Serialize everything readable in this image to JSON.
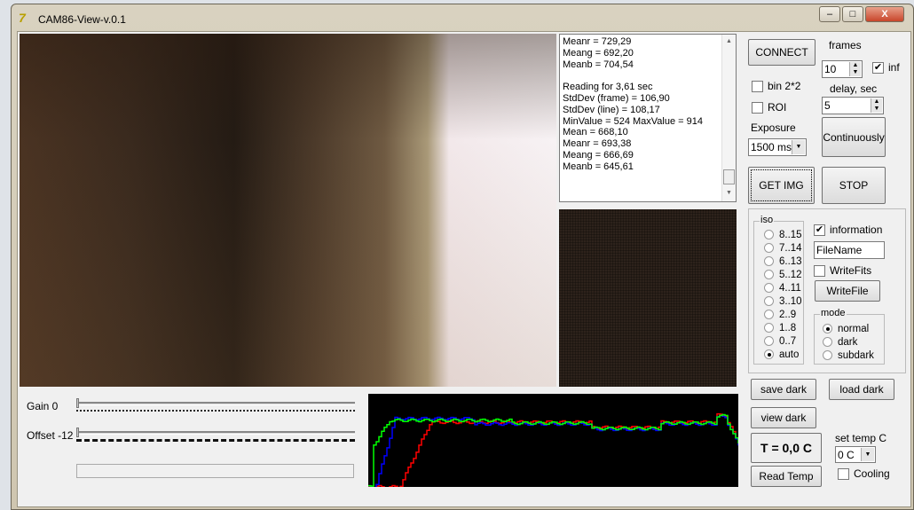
{
  "window": {
    "title": "CAM86-View-v.0.1",
    "minimize": "–",
    "maximize": "□",
    "close": "X"
  },
  "log": {
    "lines": [
      "Meanr = 729,29",
      "Meang = 692,20",
      "Meanb = 704,54",
      "",
      "Reading for 3,61 sec",
      "StdDev (frame) = 106,90",
      "StdDev (line) = 108,17",
      "MinValue = 524 MaxValue = 914",
      "Mean = 668,10",
      "Meanr = 693,38",
      "Meang = 666,69",
      "Meanb = 645,61"
    ]
  },
  "controls": {
    "connect": "CONNECT",
    "frames_label": "frames",
    "frames_value": "10",
    "inf_label": "inf",
    "inf_checked": true,
    "bin_label": "bin 2*2",
    "bin_checked": false,
    "roi_label": "ROI",
    "roi_checked": false,
    "delay_label": "delay, sec",
    "delay_value": "5",
    "exposure_label": "Exposure",
    "exposure_value": "1500 ms",
    "continuously": "Continuously",
    "get_img": "GET IMG",
    "stop": "STOP"
  },
  "iso": {
    "label": "iso",
    "options": [
      "8..15",
      "7..14",
      "6..13",
      "5..12",
      "4..11",
      "3..10",
      "2..9",
      "1..8",
      "0..7",
      "auto"
    ],
    "selected": "auto"
  },
  "info": {
    "information_label": "information",
    "information_checked": true,
    "filename": "FileName",
    "writefits_label": "WriteFits",
    "writefits_checked": false,
    "writefile": "WriteFile"
  },
  "mode": {
    "label": "mode",
    "options": [
      "normal",
      "dark",
      "subdark"
    ],
    "selected": "normal"
  },
  "dark": {
    "save": "save dark",
    "load": "load dark",
    "view": "view dark"
  },
  "temp": {
    "readout": "T = 0,0 C",
    "read": "Read Temp",
    "set_label": "set temp C",
    "set_value": "0 C",
    "cooling_label": "Cooling",
    "cooling_checked": false
  },
  "sliders": {
    "gain_label": "Gain 0",
    "gain_value": 0,
    "offset_label": "Offset -12",
    "offset_value": 0
  },
  "histogram": {
    "colors": {
      "red": "#ff0000",
      "green": "#00ff00",
      "blue": "#0000ff"
    }
  }
}
